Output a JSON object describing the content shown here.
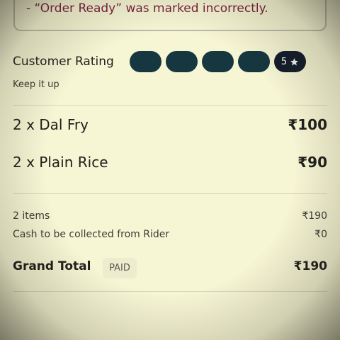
{
  "issue": {
    "text": "- “Order Ready” was marked incorrectly."
  },
  "rating": {
    "label": "Customer Rating",
    "subtitle": "Keep it up",
    "score": "5",
    "max": 5,
    "star_icon": "star-icon",
    "pill_color": "#16373f",
    "badge_color": "#131c2c"
  },
  "items": [
    {
      "name": "2 x Dal Fry",
      "price": "₹100"
    },
    {
      "name": "2 x Plain Rice",
      "price": "₹90"
    }
  ],
  "summary": {
    "items_label": "2 items",
    "items_value": "₹190",
    "cash_label": "Cash to be collected from Rider",
    "cash_value": "₹0"
  },
  "grand_total": {
    "label": "Grand Total",
    "badge": "PAID",
    "value": "₹190"
  }
}
